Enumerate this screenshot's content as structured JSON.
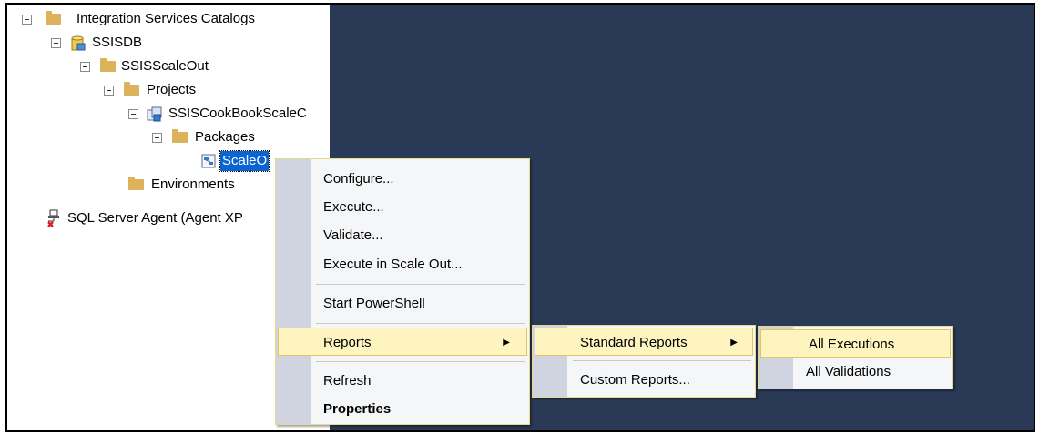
{
  "tree": {
    "items": [
      {
        "label": "Integration Services Catalogs",
        "icon": "folder-icon",
        "expanded": true
      },
      {
        "label": "SSISDB",
        "icon": "database-icon",
        "expanded": true
      },
      {
        "label": "SSISScaleOut",
        "icon": "folder-icon",
        "expanded": true
      },
      {
        "label": "Projects",
        "icon": "folder-icon",
        "expanded": true
      },
      {
        "label": "SSISCookBookScaleC",
        "icon": "project-icon",
        "expanded": true
      },
      {
        "label": "Packages",
        "icon": "folder-icon",
        "expanded": true
      },
      {
        "label": "ScaleO",
        "icon": "package-icon",
        "selected": true
      },
      {
        "label": "Environments",
        "icon": "folder-icon"
      },
      {
        "label": "SQL Server Agent (Agent XP",
        "icon": "agent-disabled-icon"
      }
    ]
  },
  "context_menu": {
    "items": [
      {
        "label": "Configure..."
      },
      {
        "label": "Execute..."
      },
      {
        "label": "Validate..."
      },
      {
        "label": "Execute in Scale Out..."
      },
      {
        "label": "Start PowerShell"
      },
      {
        "label": "Reports",
        "submenu": true,
        "highlighted": true
      },
      {
        "label": "Refresh"
      },
      {
        "label": "Properties",
        "bold": true
      }
    ]
  },
  "reports_submenu": {
    "items": [
      {
        "label": "Standard Reports",
        "submenu": true,
        "highlighted": true
      },
      {
        "label": "Custom Reports..."
      }
    ]
  },
  "standard_reports_submenu": {
    "items": [
      {
        "label": "All Executions",
        "highlighted": true
      },
      {
        "label": "All Validations"
      }
    ]
  },
  "colors": {
    "right_pane": "#2a3a56",
    "highlight": "#fdf4bf",
    "selection": "#0a64d2",
    "folder": "#dcb25a"
  }
}
